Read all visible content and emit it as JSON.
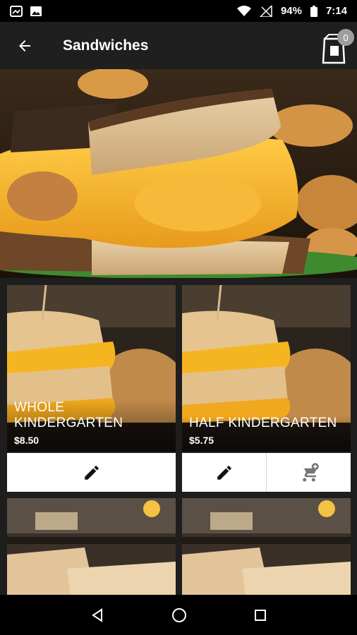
{
  "status_bar": {
    "battery": "94%",
    "time": "7:14",
    "icons": [
      "gallery-icon",
      "image-icon",
      "wifi-icon",
      "no-signal-icon",
      "battery-icon"
    ]
  },
  "app_bar": {
    "title": "Sandwiches",
    "back_icon": "arrow-back-icon",
    "cart_icon": "shopping-bag-icon",
    "cart_count": "0"
  },
  "products": [
    {
      "name": "WHOLE KINDERGARTEN",
      "price": "$8.50",
      "actions": [
        "edit-icon"
      ]
    },
    {
      "name": "HALF KINDERGARTEN",
      "price": "$5.75",
      "actions": [
        "edit-icon",
        "add-to-cart-icon"
      ]
    }
  ],
  "nav_bar": {
    "icons": [
      "back-triangle-icon",
      "home-circle-icon",
      "recents-square-icon"
    ]
  },
  "colors": {
    "app_bar": "#1f1f1f",
    "background": "#1e1e1e",
    "cheese": "#f5b82e",
    "badge": "#9e9e9e"
  }
}
